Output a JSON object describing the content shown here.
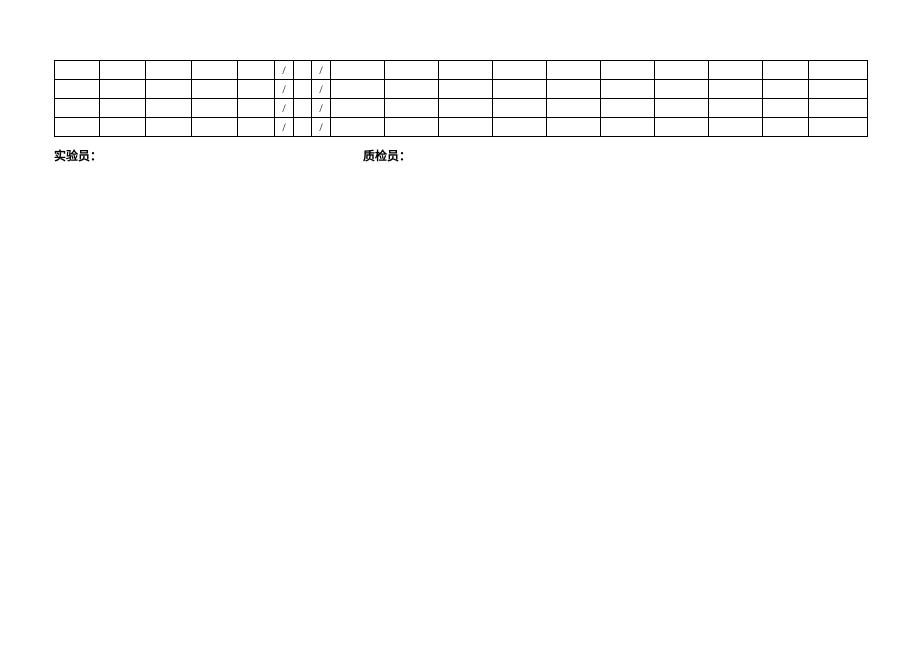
{
  "table": {
    "rows": [
      {
        "c5": "",
        "c6": "/",
        "c7": "",
        "c8": "/"
      },
      {
        "c5": "",
        "c6": "/",
        "c7": "",
        "c8": "/"
      },
      {
        "c5": "",
        "c6": "/",
        "c7": "",
        "c8": "/"
      },
      {
        "c5": "",
        "c6": "/",
        "c7": "",
        "c8": "/"
      }
    ]
  },
  "footer": {
    "tester": "实验员：",
    "inspector": "质检员："
  }
}
